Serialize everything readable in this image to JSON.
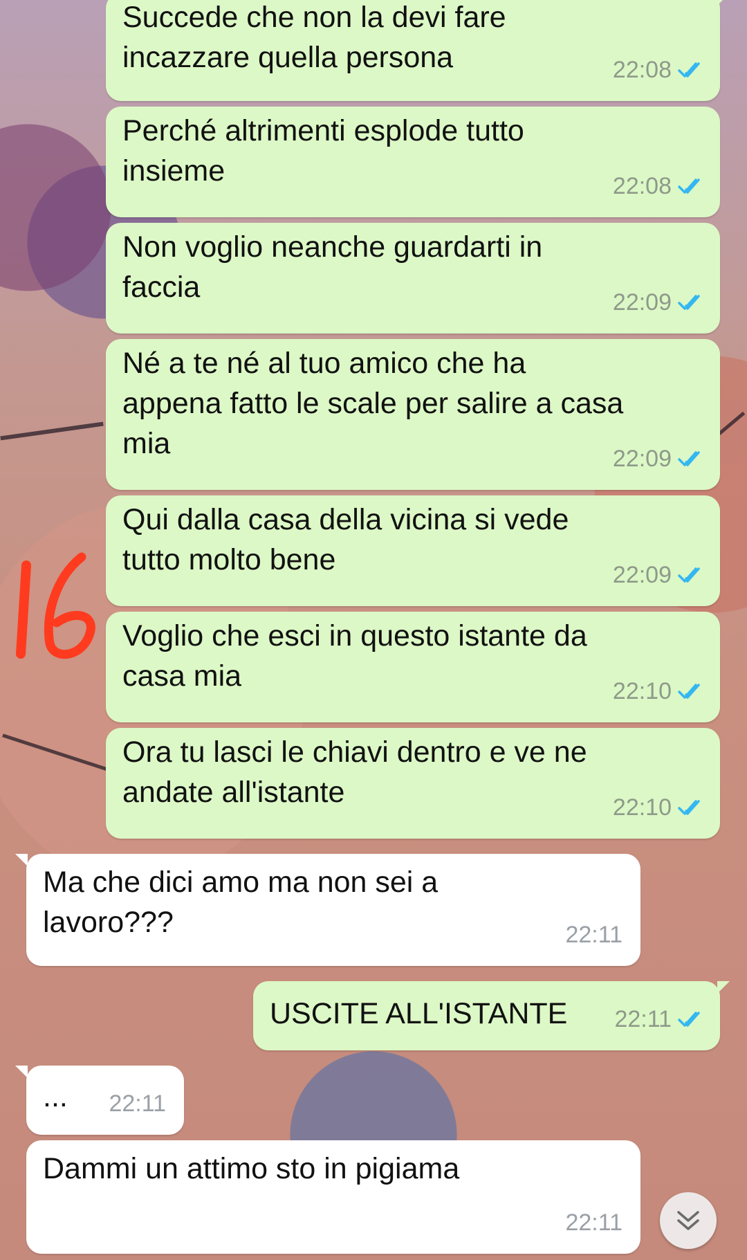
{
  "messages": [
    {
      "direction": "out",
      "text": "Succede che non la devi fare\nincazzare quella persona",
      "time": "22:08",
      "status": "read"
    },
    {
      "direction": "out",
      "text": "Perché altrimenti esplode tutto\ninsieme",
      "time": "22:08",
      "status": "read"
    },
    {
      "direction": "out",
      "text": "Non voglio neanche guardarti in\nfaccia",
      "time": "22:09",
      "status": "read"
    },
    {
      "direction": "out",
      "text": "Né a te né al tuo amico che ha\nappena fatto le scale per salire a casa\nmia",
      "time": "22:09",
      "status": "read"
    },
    {
      "direction": "out",
      "text": "Qui dalla casa della vicina si vede\ntutto molto bene",
      "time": "22:09",
      "status": "read"
    },
    {
      "direction": "out",
      "text": "Voglio che esci in questo istante da\ncasa mia",
      "time": "22:10",
      "status": "read"
    },
    {
      "direction": "out",
      "text": "Ora tu lasci le chiavi dentro e ve ne\nandate all'istante",
      "time": "22:10",
      "status": "read"
    },
    {
      "direction": "in",
      "text": "Ma che dici amo ma non sei a\nlavoro???",
      "time": "22:11"
    },
    {
      "direction": "out",
      "text": "USCITE ALL'ISTANTE",
      "time": "22:11",
      "status": "read"
    },
    {
      "direction": "in",
      "text": "...",
      "time": "22:11"
    },
    {
      "direction": "in",
      "text": "Dammi un attimo sto in pigiama",
      "time": "22:11"
    }
  ],
  "annotation": {
    "text": "16",
    "color": "#ff3b1f"
  },
  "colors": {
    "outgoing_bubble": "#dcf8c6",
    "incoming_bubble": "#ffffff",
    "read_ticks": "#34b7f1"
  },
  "scroll_button": {
    "icon": "double-chevron-down-icon"
  }
}
